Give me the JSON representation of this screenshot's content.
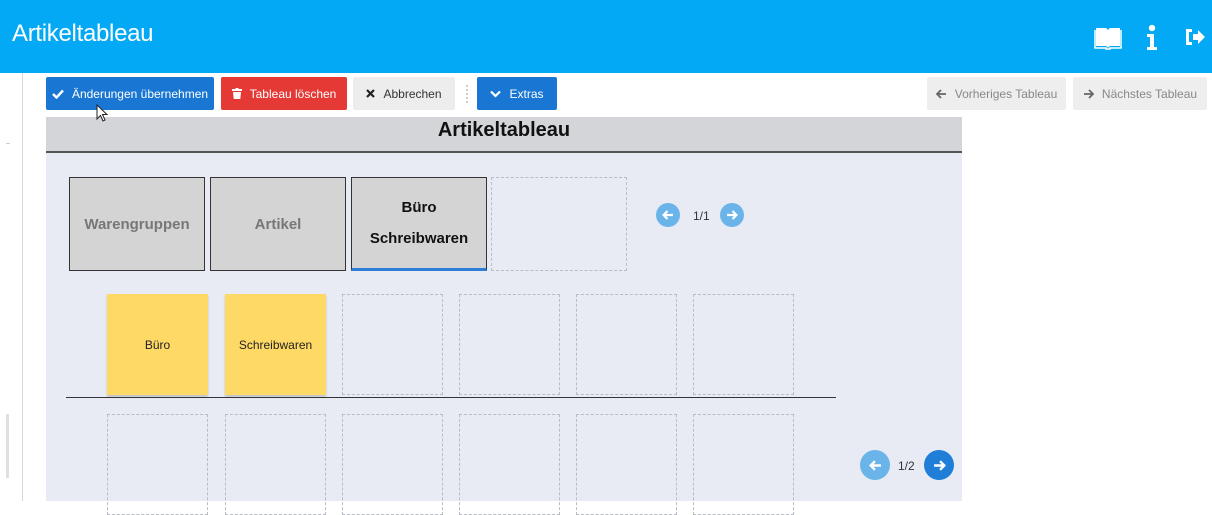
{
  "header": {
    "title": "Artikeltableau",
    "bg_color": "#03a9f4",
    "icons": [
      "book-icon",
      "info-icon",
      "logout-icon"
    ]
  },
  "toolbar": {
    "apply_label": "Änderungen übernehmen",
    "delete_label": "Tableau löschen",
    "cancel_label": "Abbrechen",
    "extras_label": "Extras",
    "prev_label": "Vorheriges Tableau",
    "next_label": "Nächstes Tableau"
  },
  "panel": {
    "title": "Artikeltableau",
    "nav_tiles": [
      {
        "label": "Warengruppen",
        "state": "normal"
      },
      {
        "label": "Artikel",
        "state": "normal"
      },
      {
        "label_line1": "Büro",
        "label_line2": "Schreibwaren",
        "state": "active"
      }
    ],
    "nav_pager": "1/1",
    "row1_items": [
      "Büro",
      "Schreibwaren"
    ],
    "bottom_pager": "1/2"
  },
  "colors": {
    "primary": "#1976d2",
    "danger": "#e53935",
    "tile_yellow": "#ffd966",
    "panel_bg": "#e8ebf4"
  }
}
